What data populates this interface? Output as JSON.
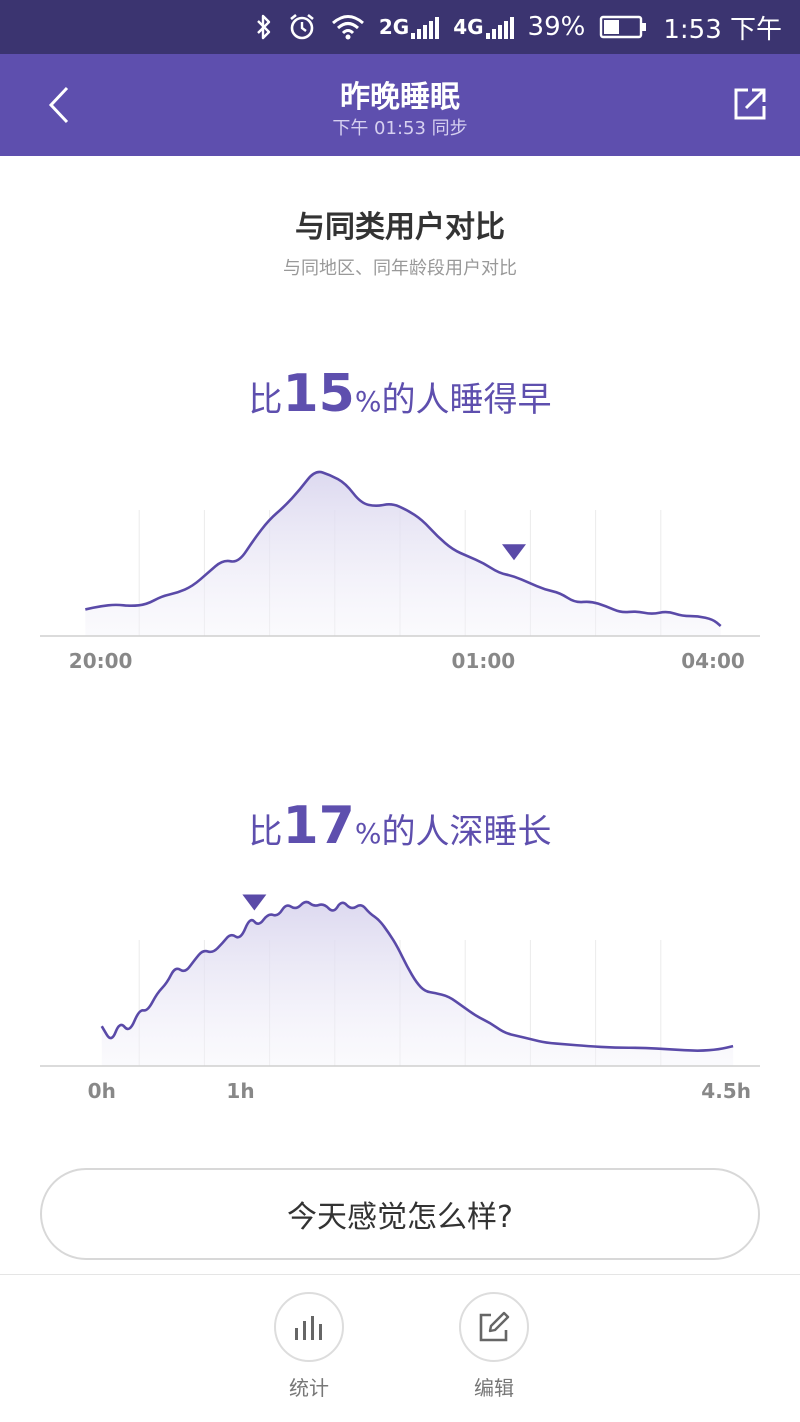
{
  "status_bar": {
    "net_2g": "2G",
    "net_4g": "4G",
    "battery": "39%",
    "time": "1:53 下午",
    "icons": [
      "bluetooth-icon",
      "alarm-icon",
      "wifi-icon",
      "signal-icon",
      "battery-icon"
    ]
  },
  "app_bar": {
    "title": "昨晚睡眠",
    "subtitle": "下午 01:53 同步",
    "icons": [
      "chevron-left-icon",
      "share-icon"
    ]
  },
  "section": {
    "title": "与同类用户对比",
    "subtitle": "与同地区、同年龄段用户对比"
  },
  "stat1": {
    "prefix": "比",
    "number": "15",
    "percent": "%",
    "suffix": "的人睡得早"
  },
  "stat2": {
    "prefix": "比",
    "number": "17",
    "percent": "%",
    "suffix": "的人深睡长"
  },
  "feeling_button": {
    "label": "今天感觉怎么样?"
  },
  "bottom_nav": {
    "stats_label": "统计",
    "edit_label": "编辑",
    "icons": [
      "bar-chart-icon",
      "edit-icon"
    ]
  },
  "colors": {
    "accent": "#5e4fae",
    "status_bar": "#3b3470",
    "line": "#5a4aa8"
  },
  "chart_data": [
    {
      "type": "area",
      "x_ticks": [
        "20:00",
        "01:00",
        "04:00"
      ],
      "x_tick_hours": [
        0,
        5,
        8
      ],
      "xlim": [
        -0.4,
        8.3
      ],
      "ylim": [
        0,
        100
      ],
      "marker_x": 5.4,
      "grid": true,
      "x": [
        -0.2,
        0.0,
        0.2,
        0.4,
        0.6,
        0.8,
        1.0,
        1.2,
        1.4,
        1.6,
        1.8,
        2.0,
        2.2,
        2.4,
        2.6,
        2.8,
        3.0,
        3.2,
        3.4,
        3.6,
        3.8,
        4.0,
        4.2,
        4.4,
        4.6,
        4.8,
        5.0,
        5.2,
        5.4,
        5.6,
        5.8,
        6.0,
        6.2,
        6.4,
        6.6,
        6.8,
        7.0,
        7.2,
        7.4,
        7.6,
        7.8,
        8.0,
        8.1
      ],
      "y": [
        16,
        18,
        19,
        18,
        19,
        24,
        26,
        30,
        38,
        46,
        44,
        58,
        70,
        78,
        88,
        100,
        97,
        92,
        80,
        78,
        80,
        76,
        70,
        60,
        52,
        48,
        44,
        38,
        36,
        32,
        28,
        26,
        20,
        21,
        18,
        14,
        15,
        13,
        15,
        12,
        12,
        10,
        6
      ]
    },
    {
      "type": "area",
      "x_ticks": [
        "0h",
        "1h",
        "4.5h"
      ],
      "x_tick_hours": [
        0,
        1,
        4.5
      ],
      "xlim": [
        -0.2,
        4.6
      ],
      "ylim": [
        0,
        100
      ],
      "marker_x": 1.1,
      "grid": true,
      "x": [
        0.0,
        0.07,
        0.13,
        0.2,
        0.27,
        0.33,
        0.4,
        0.47,
        0.53,
        0.6,
        0.67,
        0.73,
        0.8,
        0.87,
        0.93,
        1.0,
        1.07,
        1.13,
        1.2,
        1.27,
        1.33,
        1.4,
        1.47,
        1.53,
        1.6,
        1.67,
        1.73,
        1.8,
        1.87,
        1.93,
        2.0,
        2.07,
        2.13,
        2.2,
        2.27,
        2.33,
        2.4,
        2.5,
        2.6,
        2.7,
        2.8,
        2.9,
        3.0,
        3.1,
        3.2,
        3.35,
        3.5,
        3.7,
        3.9,
        4.1,
        4.3,
        4.45,
        4.55
      ],
      "y": [
        24,
        14,
        27,
        20,
        34,
        33,
        44,
        50,
        60,
        56,
        64,
        70,
        68,
        74,
        80,
        76,
        90,
        84,
        92,
        90,
        98,
        94,
        100,
        96,
        98,
        92,
        100,
        94,
        98,
        92,
        88,
        80,
        72,
        60,
        50,
        45,
        44,
        42,
        36,
        30,
        26,
        20,
        18,
        16,
        14,
        13,
        12,
        11,
        11,
        10,
        9,
        10,
        12
      ]
    }
  ]
}
